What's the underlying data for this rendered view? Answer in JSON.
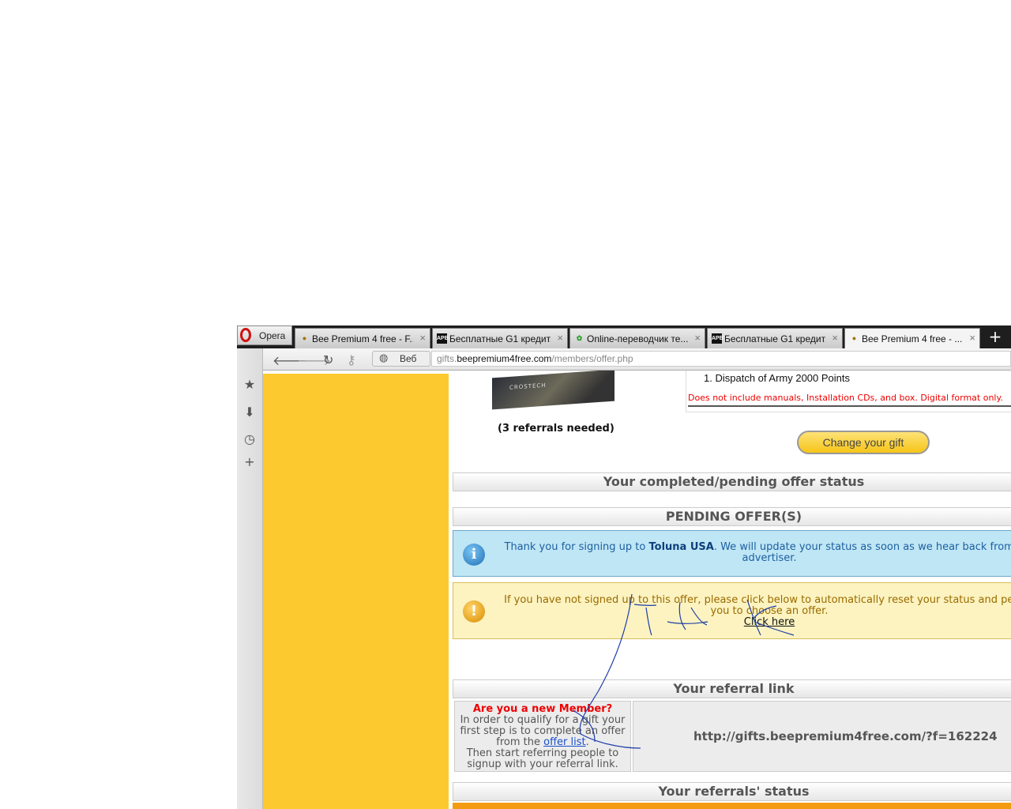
{
  "browser": {
    "menu_label": "Opera",
    "tabs": [
      {
        "title": "Bee Premium 4 free - F...",
        "icon": "bee-icon"
      },
      {
        "title": "Бесплатные G1 кредит...",
        "icon": "apb-icon"
      },
      {
        "title": "Online-переводчик те...",
        "icon": "translate-icon"
      },
      {
        "title": "Бесплатные G1 кредит...",
        "icon": "apb-icon"
      },
      {
        "title": "Bee Premium 4 free - ......",
        "icon": "bee-icon"
      }
    ],
    "new_tab_label": "+",
    "close_glyph": "×",
    "web_button_label": "Веб",
    "url": {
      "prefix": "gifts.",
      "host": "beepremium4free.com",
      "path": "/members/offer.php"
    }
  },
  "page": {
    "gift_image_caption": "CROSTECH",
    "referrals_needed": "(3 referrals needed)",
    "gift_item_number": "1.",
    "gift_item": "Dispatch of Army 2000 Points",
    "gift_note": "Does not include manuals, Installation CDs, and box. Digital format only.",
    "change_gift_button": "Change your gift",
    "status_header": "Your completed/pending offer status",
    "pending_header": "PENDING OFFER(S)",
    "info": {
      "prefix": "Thank you for signing up to ",
      "offer_name": "Toluna USA",
      "suffix": ". We will update your status as soon as we hear back from our advertiser."
    },
    "warning": {
      "text": "If you have not signed up to this offer, please click below to automatically reset your status and permit you to choose an offer.",
      "link": "Click here"
    },
    "referral_header": "Your referral link",
    "new_member": {
      "question": "Are you a new Member?",
      "line1": "In order to qualify for a gift your first step is to complete an offer from the ",
      "link": "offer list",
      "line1_end": ".",
      "line2": "Then start referring people to signup with your referral link."
    },
    "referral_url": "http://gifts.beepremium4free.com/?f=162224",
    "referrals_status_header": "Your referrals' status"
  }
}
